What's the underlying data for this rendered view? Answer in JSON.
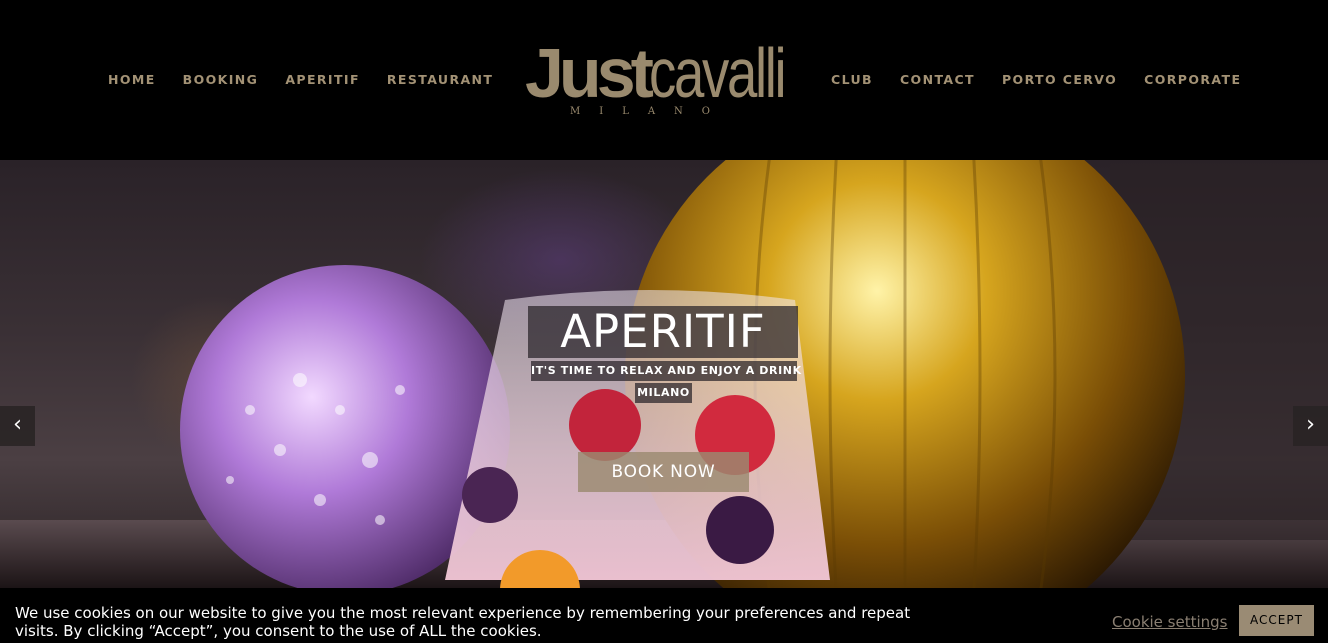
{
  "header": {
    "nav_left": [
      "HOME",
      "BOOKING",
      "APERITIF",
      "RESTAURANT"
    ],
    "nav_right": [
      "CLUB",
      "CONTACT",
      "PORTO CERVO",
      "CORPORATE"
    ],
    "logo": {
      "bold": "Just",
      "light": "cavalli",
      "sub": "MILANO"
    }
  },
  "hero": {
    "title": "APERITIF",
    "subtitle": "IT'S TIME TO RELAX AND ENJOY A DRINK",
    "city": "MILANO",
    "cta": "BOOK NOW",
    "prev_icon": "chevron-left-icon",
    "next_icon": "chevron-right-icon"
  },
  "cookie": {
    "text": "We use cookies on our website to give you the most relevant experience by remembering your preferences and repeat visits. By clicking “Accept”, you consent to the use of ALL the cookies.",
    "settings_label": "Cookie settings",
    "accept_label": "ACCEPT"
  },
  "colors": {
    "accent": "#9a8a6e",
    "background": "#000000"
  }
}
